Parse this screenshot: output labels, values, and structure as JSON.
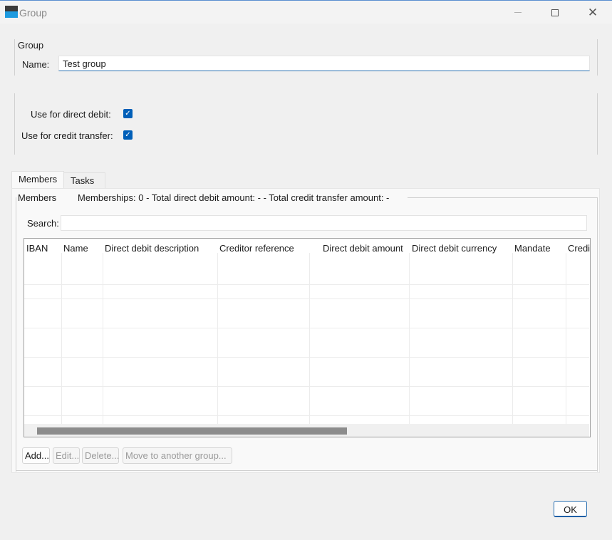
{
  "window": {
    "title": "Group"
  },
  "group_box": {
    "title": "Group",
    "name_label": "Name:",
    "name_value": "Test group"
  },
  "options": {
    "direct_debit_label": "Use for direct debit:",
    "direct_debit_checked": true,
    "credit_transfer_label": "Use for credit transfer:",
    "credit_transfer_checked": true
  },
  "tabs": [
    {
      "label": "Members",
      "active": true
    },
    {
      "label": "Tasks",
      "active": false
    }
  ],
  "members": {
    "title": "Members",
    "summary": "Memberships: 0 - Total direct debit amount: - - Total credit transfer amount: -",
    "search_label": "Search:",
    "search_value": "",
    "columns": [
      "IBAN",
      "Name",
      "Direct debit description",
      "Creditor reference",
      "Direct debit amount",
      "Direct debit currency",
      "Mandate",
      "Credi"
    ],
    "rows": []
  },
  "buttons": {
    "add": "Add...",
    "edit": "Edit...",
    "delete": "Delete...",
    "move": "Move to another group...",
    "ok": "OK"
  },
  "icons": {
    "minimize": "minimize-icon",
    "maximize": "maximize-icon",
    "close": "close-icon",
    "check": "check-icon"
  },
  "colors": {
    "accent": "#005fb8",
    "app_icon_top": "#3a3a3a",
    "app_icon_bottom": "#1e9be0"
  }
}
